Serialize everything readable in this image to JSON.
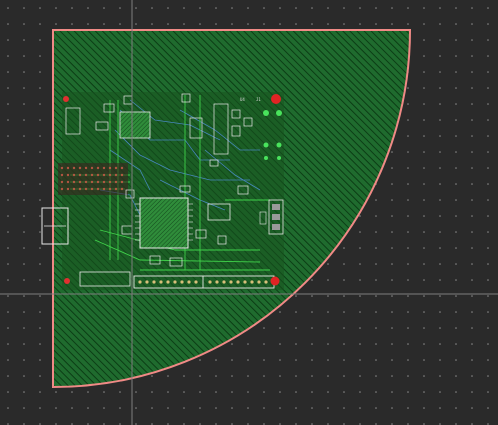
{
  "editor": {
    "view": "pcb-layout",
    "background_color": "#2a2a2a",
    "grid_dot_color": "#8a8a8a",
    "crosshair_color": "#6f6f6f",
    "board_fill_color": "#1f6b2e",
    "board_hatch_color": "#0c3d15",
    "board_outline_color": "#f08a86",
    "copper_color": "#3fd14a",
    "silkscreen_color": "#e8e8e8",
    "via_color": "#ff2a2a",
    "pad_color": "#49e35c",
    "trace_color": "#4f8fd8"
  },
  "board": {
    "component_labels": [
      "U4",
      "J1"
    ],
    "connectors": [
      "usb-connector",
      "header-bottom",
      "header-side"
    ],
    "chips": [
      "main-mcu",
      "small-ic"
    ]
  }
}
